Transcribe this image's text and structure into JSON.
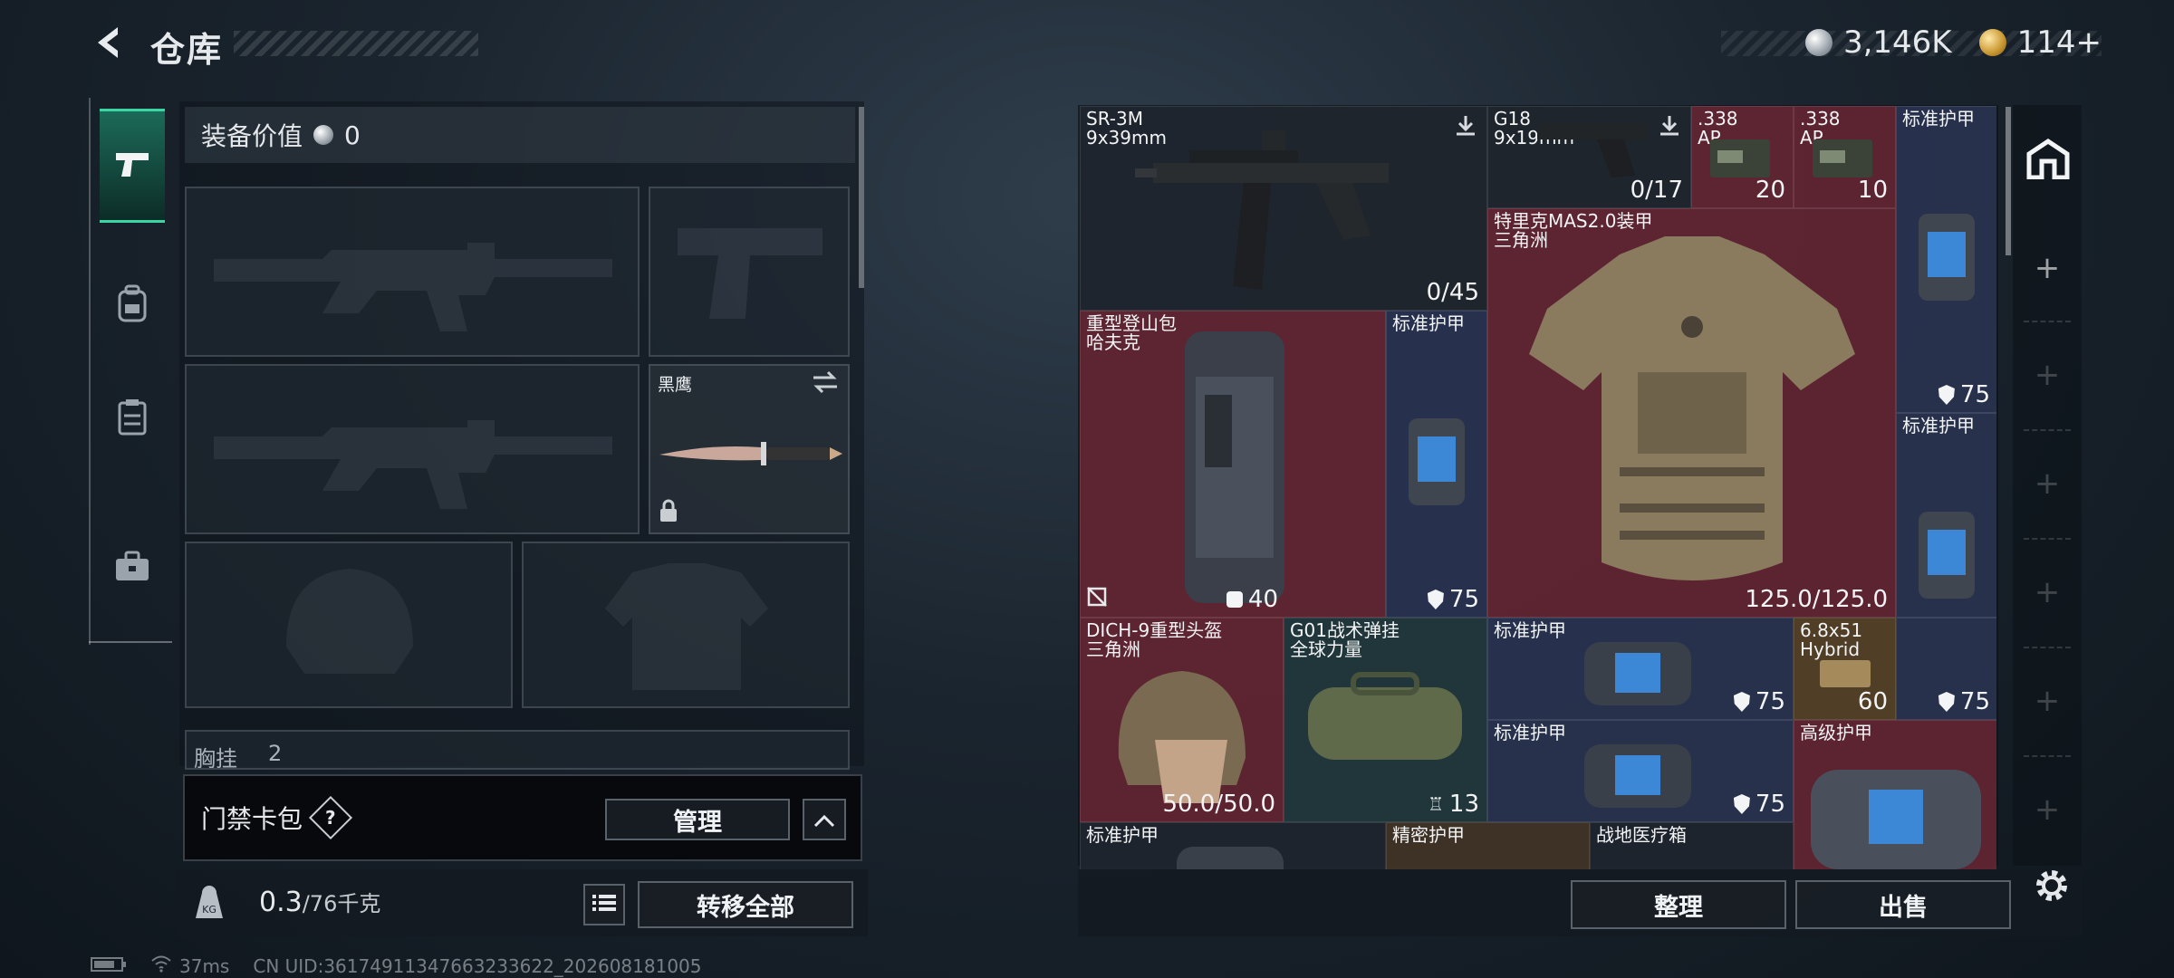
{
  "header": {
    "title": "仓库",
    "silver": "3,146K",
    "gold": "114+"
  },
  "equipment": {
    "value_label": "装备价值",
    "value": "0",
    "knife_label": "黑鹰",
    "chest_label": "胸挂",
    "chest_count": "2"
  },
  "keycard": {
    "label": "门禁卡包",
    "help": "?",
    "manage": "管理"
  },
  "weight": {
    "current": "0.3",
    "max": "/76千克",
    "transfer_all": "转移全部"
  },
  "stash": {
    "items": [
      {
        "name": "SR-3M\n9x39mm",
        "value": "0/45"
      },
      {
        "name": "G18\n9x19mm",
        "value": "0/17"
      },
      {
        "name": ".338\nAP",
        "value": "20"
      },
      {
        "name": ".338\nAP",
        "value": "10"
      },
      {
        "name": "标准护甲",
        "value": "75"
      },
      {
        "name": "特里克MAS2.0装甲\n三角洲",
        "value": "125.0/125.0"
      },
      {
        "name": "重型登山包\n哈夫克",
        "value": "40"
      },
      {
        "name": "标准护甲",
        "value": "75"
      },
      {
        "name": "标准护甲",
        "value": ""
      },
      {
        "name": "DICH-9重型头盔\n三角洲",
        "value": "50.0/50.0"
      },
      {
        "name": "G01战术弹挂\n全球力量",
        "value": "13"
      },
      {
        "name": "标准护甲",
        "value": "75"
      },
      {
        "name": "6.8x51\nHybrid",
        "value": "60"
      },
      {
        "name": "",
        "value": "75"
      },
      {
        "name": "标准护甲",
        "value": "75"
      },
      {
        "name": "高级护甲",
        "value": ""
      },
      {
        "name": "标准护甲",
        "value": ""
      },
      {
        "name": "精密护甲",
        "value": ""
      },
      {
        "name": "战地医疗箱",
        "value": ""
      }
    ]
  },
  "actions": {
    "sort": "整理",
    "sell": "出售"
  },
  "status": {
    "ping": "37ms",
    "uid": "CN UID:36174911347663233622_202608181005"
  },
  "colors": {
    "accent_green": "#3bd5a3",
    "rarity_red": "#682634",
    "rarity_blue": "#2a3452",
    "rarity_green": "#223a3e",
    "rarity_gold": "#5c4628"
  }
}
